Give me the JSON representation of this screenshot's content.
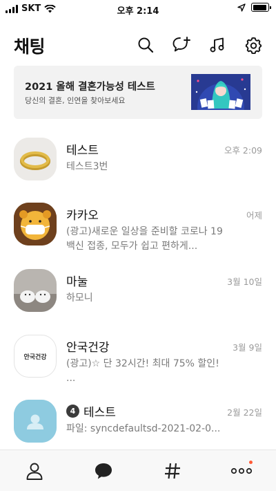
{
  "status_bar": {
    "carrier": "SKT",
    "time": "오후 2:14",
    "battery_level": 0.95
  },
  "header": {
    "title": "채팅",
    "icons": [
      "search-icon",
      "new-chat-icon",
      "music-icon",
      "settings-icon"
    ]
  },
  "banner": {
    "title": "2021 올해 결혼가능성 테스트",
    "subtitle": "당신의 결혼, 인연을 찾아보세요"
  },
  "chats": [
    {
      "name": "테스트",
      "message": "테스트3번",
      "time": "오후 2:09",
      "avatar": "ring-avatar"
    },
    {
      "name": "카카오",
      "message": "(광고)새로운 일상을 준비할 코로나 19 백신 접종, 모두가 쉽고 편하게...",
      "time": "어제",
      "avatar": "kakao-character-avatar"
    },
    {
      "name": "마눌",
      "message": "하모니",
      "time": "3월 10일",
      "avatar": "slippers-avatar"
    },
    {
      "name": "안국건강",
      "message": "(광고)☆ 단 32시간! 최대 75% 할인! ...",
      "time": "3월 9일",
      "avatar": "brand-logo-avatar",
      "logo_text": "안국건강"
    },
    {
      "name": "테스트",
      "member_count": "4",
      "message": "파일: syncdefaultsd-2021-02-0...",
      "time": "2월 22일",
      "avatar": "default-profile-avatar"
    }
  ],
  "tabbar": {
    "tabs": [
      "friends-icon",
      "chats-icon",
      "view-hashtag-icon",
      "more-icon"
    ],
    "active_tab": "chats",
    "colors": {
      "notification_dot": "#ff5a36",
      "default_avatar": "#8ecbe0"
    }
  }
}
